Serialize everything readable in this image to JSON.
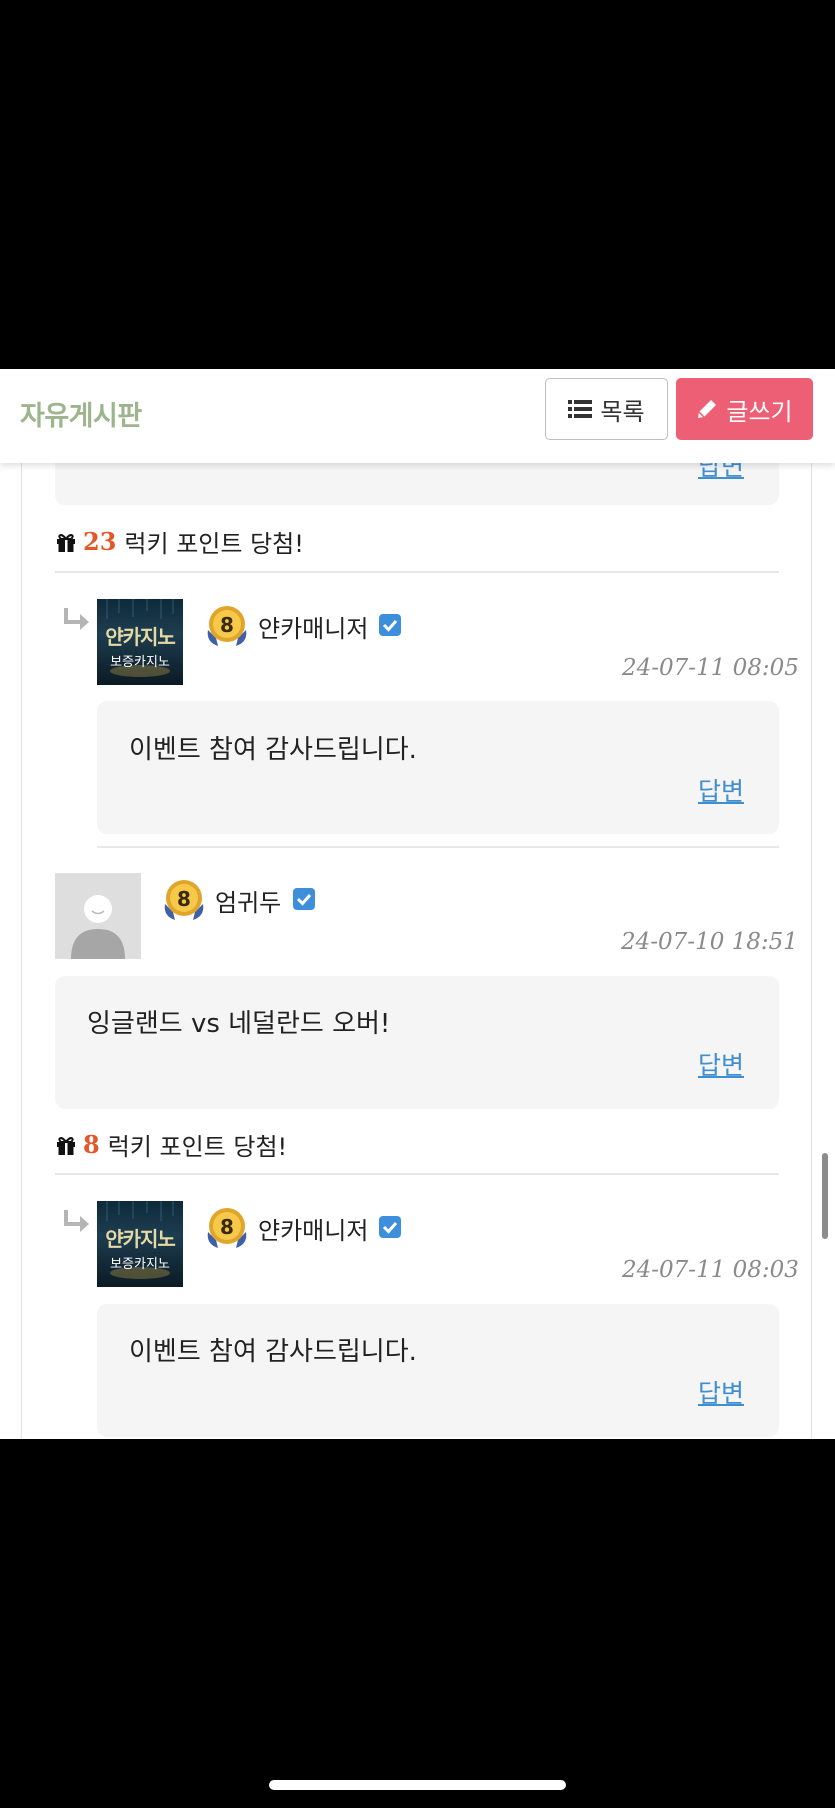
{
  "header": {
    "title": "자유게시판",
    "list_button": "목록",
    "write_button": "글쓰기",
    "write_color": "#ec5f74",
    "title_color": "#9db58c"
  },
  "comments": [
    {
      "partial_reply": "답변"
    },
    {
      "lucky_points": "23",
      "lucky_text": "럭키 포인트 당첨!",
      "reply": {
        "avatar_line1": "얀카지노",
        "avatar_line2": "보증카지노",
        "level": "8",
        "nickname": "얀카매니저",
        "date": "24-07-11 08:05",
        "text": "이벤트 참여 감사드립니다.",
        "reply_label": "답변"
      }
    },
    {
      "level": "8",
      "nickname": "엄귀두",
      "date": "24-07-10 18:51",
      "text": "잉글랜드 vs 네덜란드 오버!",
      "reply_label": "답변",
      "lucky_points": "8",
      "lucky_text": "럭키 포인트 당첨!",
      "reply": {
        "avatar_line1": "얀카지노",
        "avatar_line2": "보증카지노",
        "level": "8",
        "nickname": "얀카매니저",
        "date": "24-07-11 08:03",
        "text": "이벤트 참여 감사드립니다.",
        "reply_label": "답변"
      }
    }
  ],
  "icons": {
    "list": "list-icon",
    "write": "pencil-icon",
    "gift": "gift-icon",
    "reply_arrow": "reply-arrow-icon",
    "verified": "verified-check-icon",
    "level_badge": "level-badge-icon"
  },
  "accent_colors": {
    "lucky_number": "#e2582a",
    "link": "#3f8fd0",
    "verified": "#3d8edb"
  }
}
